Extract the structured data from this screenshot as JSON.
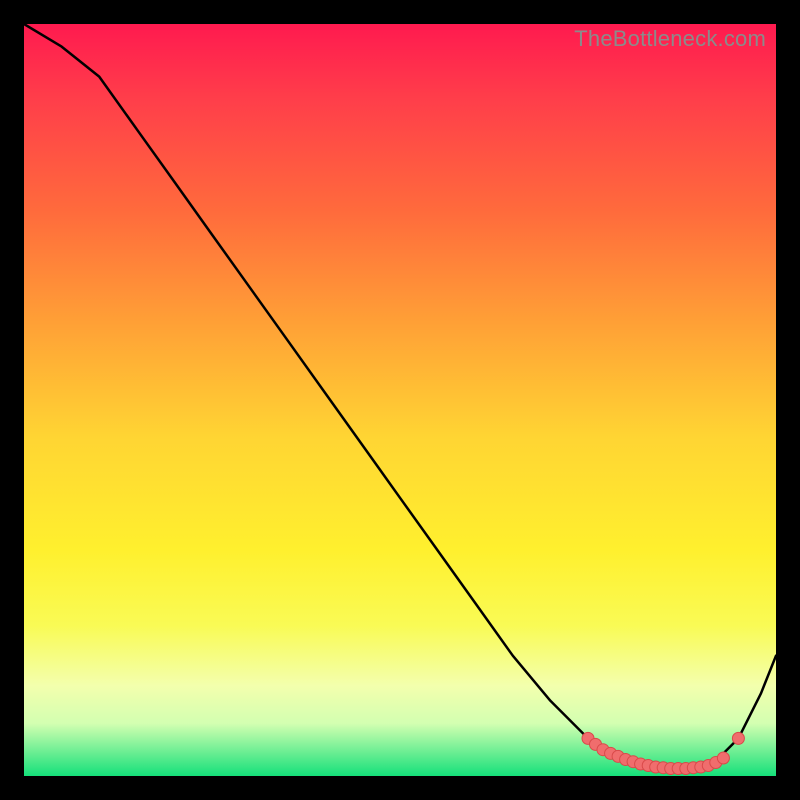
{
  "watermark": "TheBottleneck.com",
  "colors": {
    "page_bg": "#000000",
    "line": "#000000",
    "dots_fill": "#f06d6d",
    "dots_stroke": "#d94a4a",
    "gradient_stops": [
      "#ff1a4f",
      "#ff3e4a",
      "#ff6b3c",
      "#ffa136",
      "#ffd533",
      "#fff02e",
      "#f9fb55",
      "#f3ffad",
      "#d3ffb1",
      "#15e07a"
    ]
  },
  "chart_data": {
    "type": "line",
    "title": "",
    "xlabel": "",
    "ylabel": "",
    "xlim": [
      0,
      100
    ],
    "ylim": [
      0,
      100
    ],
    "grid": false,
    "annotations": [
      "TheBottleneck.com"
    ],
    "series": [
      {
        "name": "curve",
        "x": [
          0,
          5,
          10,
          15,
          20,
          25,
          30,
          35,
          40,
          45,
          50,
          55,
          60,
          65,
          70,
          75,
          78,
          80,
          82,
          84,
          86,
          88,
          90,
          92,
          95,
          98,
          100
        ],
        "y": [
          100,
          97,
          93,
          86,
          79,
          72,
          65,
          58,
          51,
          44,
          37,
          30,
          23,
          16,
          10,
          5,
          3,
          2,
          1.5,
          1.2,
          1,
          1,
          1.2,
          2,
          5,
          11,
          16
        ]
      }
    ],
    "highlight_points": {
      "name": "dots",
      "x": [
        75,
        76,
        77,
        78,
        79,
        80,
        81,
        82,
        83,
        84,
        85,
        86,
        87,
        88,
        89,
        90,
        91,
        92,
        93,
        95
      ],
      "y": [
        5,
        4.2,
        3.5,
        3,
        2.6,
        2.2,
        1.9,
        1.6,
        1.4,
        1.2,
        1.1,
        1,
        1,
        1,
        1.1,
        1.2,
        1.4,
        1.8,
        2.4,
        5
      ]
    }
  }
}
